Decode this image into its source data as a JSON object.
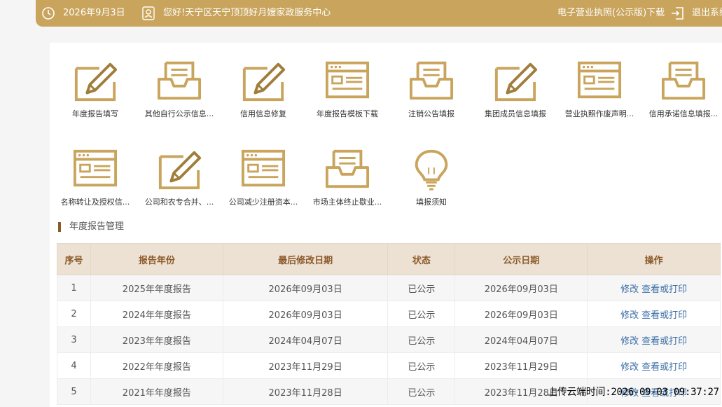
{
  "topbar": {
    "date": "2026年9月3日",
    "welcome": "您好!天宁区天宁顶顶好月嫂家政服务中心",
    "license_download": "电子营业执照(公示版)下载",
    "logout": "退出系统",
    "icons": {
      "date": "clock-icon",
      "user": "user-icon",
      "logout": "logout-icon"
    }
  },
  "tiles": [
    {
      "label": "年度报告填写",
      "icon": "pencil"
    },
    {
      "label": "其他自行公示信息...",
      "icon": "tray"
    },
    {
      "label": "信用信息修复",
      "icon": "pencil"
    },
    {
      "label": "年度报告模板下载",
      "icon": "form"
    },
    {
      "label": "注销公告填报",
      "icon": "tray"
    },
    {
      "label": "集团成员信息填报",
      "icon": "pencil"
    },
    {
      "label": "营业执照作废声明...",
      "icon": "form"
    },
    {
      "label": "信用承诺信息填报...",
      "icon": "tray"
    },
    {
      "label": "名称转让及授权信...",
      "icon": "form"
    },
    {
      "label": "公司和农专合并、...",
      "icon": "pencil"
    },
    {
      "label": "公司减少注册资本...",
      "icon": "form"
    },
    {
      "label": "市场主体终止歇业...",
      "icon": "tray"
    },
    {
      "label": "填报须知",
      "icon": "bulb"
    }
  ],
  "section": {
    "title": "年度报告管理"
  },
  "table": {
    "headers": [
      "序号",
      "报告年份",
      "最后修改日期",
      "状态",
      "公示日期",
      "操作"
    ],
    "rows": [
      {
        "no": "1",
        "year": "2025年年度报告",
        "modified": "2026年09月03日",
        "status": "已公示",
        "published": "2026年09月03日",
        "edit": "修改",
        "view": "查看或打印"
      },
      {
        "no": "2",
        "year": "2024年年度报告",
        "modified": "2026年09月03日",
        "status": "已公示",
        "published": "2026年09月03日",
        "edit": "修改",
        "view": "查看或打印"
      },
      {
        "no": "3",
        "year": "2023年年度报告",
        "modified": "2024年04月07日",
        "status": "已公示",
        "published": "2024年04月07日",
        "edit": "修改",
        "view": "查看或打印"
      },
      {
        "no": "4",
        "year": "2022年年度报告",
        "modified": "2023年11月29日",
        "status": "已公示",
        "published": "2023年11月29日",
        "edit": "修改",
        "view": "查看或打印"
      },
      {
        "no": "5",
        "year": "2021年年度报告",
        "modified": "2023年11月28日",
        "status": "已公示",
        "published": "2023年11月28日",
        "edit": "修改",
        "view": "查看或打印"
      }
    ]
  },
  "watermark": "上传云端时间:2026-09-03 09:37:27",
  "colors": {
    "gold": "#c9a45c",
    "brown": "#8b5a2b",
    "link": "#3a6ea5"
  }
}
